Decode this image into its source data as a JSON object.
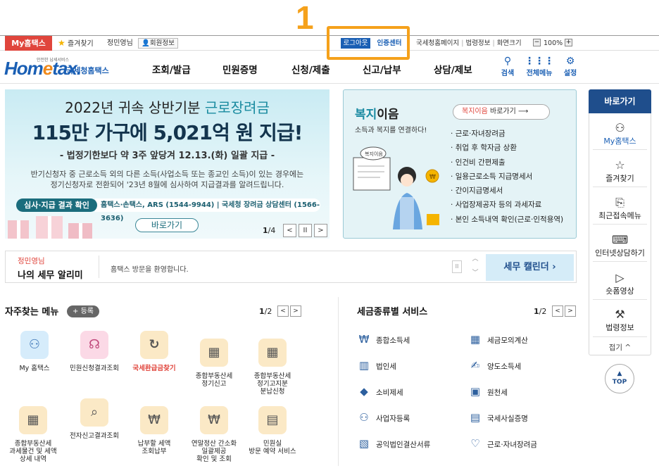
{
  "annotation": {
    "number": "1"
  },
  "util": {
    "myhome": "My홈택스",
    "favorites": "즐겨찾기",
    "user": "정민영님",
    "member_info": "회원정보",
    "logout": "로그아웃",
    "cert_center": "인증센터",
    "nts_home": "국세청홈페이지",
    "law_info": "법령정보",
    "screen_size": "화면크기",
    "zoom_minus": "−",
    "zoom_value": "100%",
    "zoom_plus": "+"
  },
  "header": {
    "logo_small": "안전한 납세서비스",
    "logo_home": "Hom",
    "logo_e": "e",
    "logo_tax": "tax.",
    "logo_text": "국세청홈택스",
    "gnb": [
      "조회/발급",
      "민원증명",
      "신청/제출",
      "신고/납부",
      "상담/제보"
    ],
    "tools": [
      {
        "label": "검색",
        "icon": "search-icon"
      },
      {
        "label": "전체메뉴",
        "icon": "grid-icon"
      },
      {
        "label": "설정",
        "icon": "gear-icon"
      }
    ]
  },
  "banner": {
    "line1_pre": "2022년 귀속 상반기분 ",
    "line1_hl": "근로장려금",
    "line2": "115만 가구에 5,021억 원 지급!",
    "line3": "- 법정기한보다 약 3주 앞당겨 12.13.(화) 일괄 지급 -",
    "line4a": "반기신청자 중 근로소득 외의 다른 소득(사업소득 또는 종교인 소득)이 있는 경우에는",
    "line4b": "정기신청자로 전환되어 '23년 8월에 심사하여 지급결과를 알려드립니다.",
    "tag": "심사·지급 결과 확인",
    "contact": "홈택스·손택스, ARS (1544-9944) | 국세청 장려금 상담센터 (1566-3636)",
    "go": "바로가기",
    "page_current": "1",
    "page_total": "/4",
    "prev": "<",
    "pause": "II",
    "next": ">"
  },
  "welfare": {
    "title_a": "복지",
    "title_b": "이음",
    "sub": "소득과 복지를 연결하다!",
    "link_a": "복지이음",
    "link_b": " 바로가기  ⟶",
    "items": [
      "근로·자녀장려금",
      "취업 후 학자금 상환",
      "인건비 간편제출",
      "일용근로소득 지급명세서",
      "간이지급명세서",
      "사업장제공자 등의 과세자료",
      "본인 소득내역 확인(근로·인적용역)"
    ],
    "speech": "복지이음"
  },
  "quick": {
    "title": "바로가기",
    "items": [
      {
        "label": "My홈택스",
        "icon": "person-icon"
      },
      {
        "label": "즐겨찾기",
        "icon": "star-icon"
      },
      {
        "label": "최근접속메뉴",
        "icon": "recent-icon"
      },
      {
        "label": "인터넷상담하기",
        "icon": "laptop-icon"
      },
      {
        "label": "숏폼영상",
        "icon": "play-icon"
      },
      {
        "label": "법령정보",
        "icon": "gavel-icon"
      }
    ],
    "fold": "접기 ^",
    "top": "TOP"
  },
  "notice": {
    "user": "정민영님",
    "title": "나의 세무 알리미",
    "message": "홈택스 방문을 환영합니다.",
    "pause": "II",
    "calendar": "세무 캘린더  ›"
  },
  "frequent": {
    "title": "자주찾는 메뉴",
    "register": "+ 등록",
    "page": "1",
    "total": "/2",
    "items": [
      {
        "label": "My 홈택스",
        "icon": "person-icon",
        "style": "blue",
        "red": false
      },
      {
        "label": "민원신청결과조회",
        "icon": "headset-icon",
        "style": "pink",
        "red": false
      },
      {
        "label": "국세환급금찾기",
        "icon": "refund-icon",
        "style": "",
        "red": true
      },
      {
        "label": "종합부동산세\n정기신고",
        "icon": "calendar-icon",
        "style": "",
        "red": false
      },
      {
        "label": "종합부동산세\n정기고지분\n분납신청",
        "icon": "calendar-check-icon",
        "style": "",
        "red": false
      },
      {
        "label": "종합부동산세\n과세물건 및 세액\n상세 내역",
        "icon": "calendar-list-icon",
        "style": "",
        "red": false
      },
      {
        "label": "전자신고결과조회",
        "icon": "search-doc-icon",
        "style": "",
        "red": false
      },
      {
        "label": "납부할 세액\n조회납부",
        "icon": "money-icon",
        "style": "",
        "red": false
      },
      {
        "label": "연말정산 간소화\n일괄제공\n확인 및 조회",
        "icon": "money-hand-icon",
        "style": "",
        "red": false
      },
      {
        "label": "민원실\n방문 예약 서비스",
        "icon": "ticket-icon",
        "style": "",
        "red": false
      }
    ]
  },
  "tax_services": {
    "title": "세금종류별 서비스",
    "page": "1",
    "total": "/2",
    "items": [
      {
        "label": "종합소득세",
        "icon": "won-icon"
      },
      {
        "label": "세금모의계산",
        "icon": "calculator-icon"
      },
      {
        "label": "법인세",
        "icon": "building-icon"
      },
      {
        "label": "양도소득세",
        "icon": "handshake-icon"
      },
      {
        "label": "소비제세",
        "icon": "diamond-icon"
      },
      {
        "label": "원천세",
        "icon": "calendar-won-icon"
      },
      {
        "label": "사업자등록",
        "icon": "person-icon"
      },
      {
        "label": "국세사실증명",
        "icon": "document-icon"
      },
      {
        "label": "공익법인결산서류",
        "icon": "clipboard-icon"
      },
      {
        "label": "근로·자녀장려금",
        "icon": "heart-icon"
      }
    ]
  }
}
